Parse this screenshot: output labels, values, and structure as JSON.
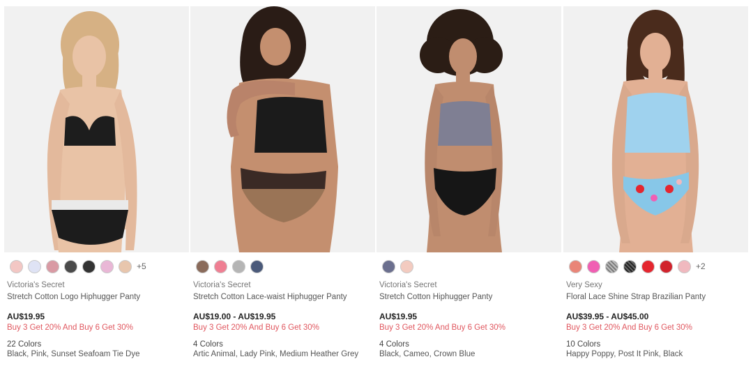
{
  "products": [
    {
      "brand": "Victoria's Secret",
      "name": "Stretch Cotton Logo Hiphugger Panty",
      "price": "AU$19.95",
      "promo": "Buy 3 Get 20% And Buy 6 Get 30%",
      "colors_count": "22 Colors",
      "color_names": "Black, Pink, Sunset Seafoam Tie Dye",
      "more_swatches": "+5",
      "swatches": [
        "#f3c7c4",
        "#dfe3f5",
        "#d99aa4",
        "#4a4a4a",
        "#333333",
        "#e9b7d6",
        "#e8c6ad"
      ],
      "colors": {
        "skin": "#e9c3a6",
        "hair": "#d6b184",
        "top": "#1d1d1d",
        "bottom": "#1c1c1c"
      }
    },
    {
      "brand": "Victoria's Secret",
      "name": "Stretch Cotton Lace-waist Hiphugger Panty",
      "price": "AU$19.00 - AU$19.95",
      "promo": "Buy 3 Get 20% And Buy 6 Get 30%",
      "colors_count": "4 Colors",
      "color_names": "Artic Animal, Lady Pink, Medium Heather Grey",
      "more_swatches": "",
      "swatches": [
        "#8a6b5b",
        "#ef7f93",
        "#b5b5b5",
        "#4b5a7a"
      ],
      "colors": {
        "skin": "#c48f6f",
        "hair": "#2a1c16",
        "top": "#1b1b1b",
        "bottom": "#9a7456"
      }
    },
    {
      "brand": "Victoria's Secret",
      "name": "Stretch Cotton Hiphugger Panty",
      "price": "AU$19.95",
      "promo": "Buy 3 Get 20% And Buy 6 Get 30%",
      "colors_count": "4 Colors",
      "color_names": "Black, Cameo, Crown Blue",
      "more_swatches": "",
      "swatches": [
        "#6b6f8e",
        "#f3cbc0"
      ],
      "colors": {
        "skin": "#c08d6f",
        "hair": "#2b1d15",
        "top": "#7f7f93",
        "bottom": "#161616"
      }
    },
    {
      "brand": "Very Sexy",
      "name": "Floral Lace Shine Strap Brazilian Panty",
      "price": "AU$39.95 - AU$45.00",
      "promo": "Buy 3 Get 20% And Buy 6 Get 30%",
      "colors_count": "10 Colors",
      "color_names": "Happy Poppy, Post It Pink, Black",
      "more_swatches": "+2",
      "swatches": [
        "#e98578",
        "#f05fb3",
        "#8f8f8f",
        "#3a3a3a",
        "#e4262f",
        "#d1232c",
        "#f0b9bf"
      ],
      "colors": {
        "skin": "#e2b094",
        "hair": "#4a2b1c",
        "top": "#9fd2ee",
        "bottom": "#87c7e8"
      }
    }
  ]
}
